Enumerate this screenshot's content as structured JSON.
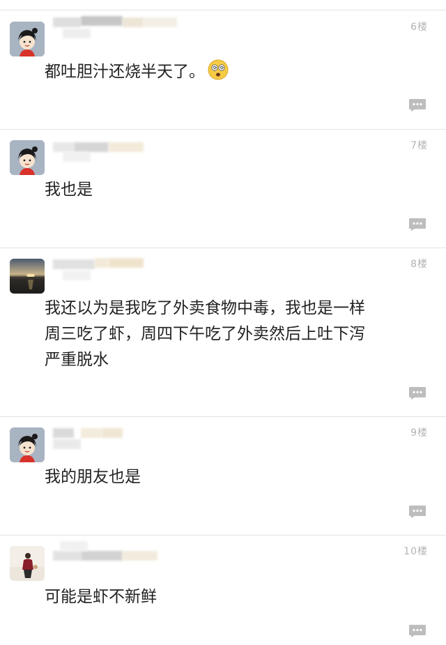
{
  "posts": [
    {
      "floor": "6楼",
      "text": "都吐胆汁还烧半天了。",
      "emoji": "dizzy-face-emoji",
      "avatar": "cartoon-girl-avatar"
    },
    {
      "floor": "7楼",
      "text": "我也是",
      "avatar": "cartoon-girl-avatar"
    },
    {
      "floor": "8楼",
      "lines": [
        "我还以为是我吃了外卖食物中毒，我也是一样",
        "周三吃了虾，周四下午吃了外卖然后上吐下泻",
        "严重脱水"
      ],
      "avatar": "sunset-lake-avatar"
    },
    {
      "floor": "9楼",
      "text": "我的朋友也是",
      "avatar": "cartoon-girl-avatar"
    },
    {
      "floor": "10楼",
      "text": "可能是虾不新鲜",
      "avatar": "person-photo-avatar"
    }
  ],
  "reply_icon": "comment-bubble-icon",
  "colors": {
    "divider": "#e3e3e3",
    "floor_text": "#b3b3b3",
    "body_text": "#222222",
    "reply_icon": "#bdbdbd"
  }
}
